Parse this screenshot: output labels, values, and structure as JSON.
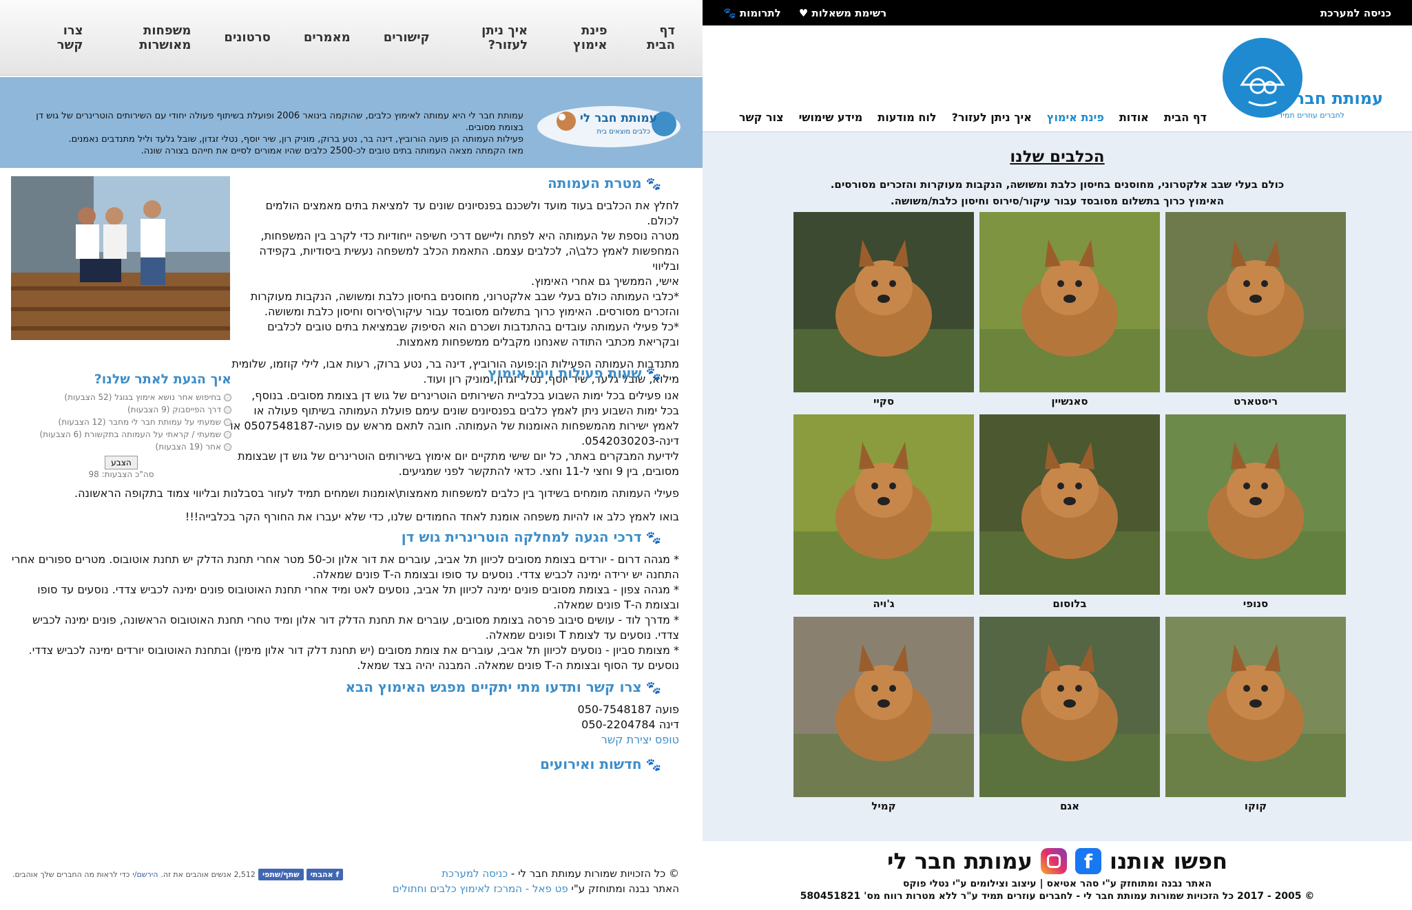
{
  "left": {
    "nav": [
      "דף הבית",
      "פינת אימוץ",
      "איך ניתן לעזור?",
      "קישורים",
      "מאמרים",
      "סרטונים",
      "משפחות מאושרות",
      "צרו קשר"
    ],
    "header_desc": [
      "עמותת חבר לי היא עמותה לאימוץ כלבים, שהוקמה בינואר 2006 ופועלת בשיתוף פעולה יחודי עם השירותים הוטרינרים של גוש דן בצומת מסובים.",
      "פעילות העמותה הן פועה הורוביץ, דינה בר, נטע ברוק, מוניק רון, שיר יוסף, נטלי זגדון, שובל גלעד וליל מתנדבים נאמנים.",
      "מאז הקמתה מצאה העמותה בתים טובים לכ-2500 כלבים שהיו אמורים לסיים את חייהם בצורה שונה."
    ],
    "logo_text": "עמותת חבר לי",
    "logo_sub": "כלבים מוצאים בית",
    "sections": [
      {
        "title": "מטרת העמותה",
        "paragraphs": [
          "לחלץ את הכלבים בעוד מועד ולשכנם בפנסיונים שונים עד למציאת בתים מאמצים הולמים לכולם.",
          "מטרה נוספת של העמותה היא לפתח וליישם דרכי חשיפה ייחודיות כדי לקרב בין המשפחות,",
          "המחפשות לאמץ כלב\\ה, לכלבים עצמם. התאמת הכלב למשפחה נעשית ביסודיות, בקפידה ובליווי",
          "אישי, הממשיך גם אחרי האימוץ.",
          "*כלבי העמותה כולם בעלי שבב אלקטרוני, מחוסנים בחיסון כלבת ומשושה, הנקבות מעוקרות",
          "והזכרים מסורסים. האימוץ כרוך בתשלום מסובסד עבור עיקור\\סירוס וחיסון כלבת ומשושה.",
          "*כל פעילי העמותה עובדים בהתנדבות ושכרם הוא הסיפוק שבמציאת בתים טובים לכלבים",
          "ובקריאת מכתבי התודה שאנחנו מקבלים ממשפחות מאמצות.",
          "",
          "מתנדבות העמותה הפעילות הן:פועה הורוביץ, דינה בר, נטע ברוק, רעות אבו, לילי קוזמו, שלומית",
          "מילוא, שובל גלעד, שיר יוסף, נטלי זגדון, מוניק רון ועוד."
        ]
      },
      {
        "title": "שעות פעילות וימי אימוץ",
        "paragraphs": [
          "אנו פעילים בכל ימות השבוע בכלביית השירותים הוטרינרים של גוש דן בצומת מסובים. בנוסף,",
          "בכל ימות השבוע ניתן לאמץ כלבים בפנסיונים שונים עימם פועלת העמותה בשיתוף פעולה או",
          "לאמץ ישירות מהמשפחות האומנות של העמותה. חובה לתאם מראש עם פועה-0507548187 או",
          "דינה-0542030203.",
          "לידיעת המבקרים באתר, כל יום שישי מתקיים יום אימוץ בשירותים הוטרינרים של גוש דן שבצומת",
          "מסובים, בין 9 וחצי ל-11 וחצי. כדאי להתקשר לפני שמגיעים.",
          "",
          "פעילי העמותה מומחים בשידוך בין כלבים למשפחות מאמצות\\אומנות ושמחים תמיד לעזור בסבלנות ובליווי צמוד בתקופה הראשונה.",
          "",
          "בואו לאמץ כלב או להיות משפחה אומנת לאחד החמודים שלנו, כדי שלא יעברו את החורף הקר בכלבייה!!!"
        ]
      },
      {
        "title": "דרכי הגעה למחלקה הוטרינרית גוש דן",
        "paragraphs": [
          "* מגהה דרום - יורדים בצומת מסובים לכיוון תל אביב, עוברים את דור אלון וכ-50 מטר אחרי תחנת הדלק יש תחנת אוטובוס. מטרים ספורים אחרי",
          "התחנה יש ירידה ימינה לכביש צדדי. נוסעים עד סופו ובצומת ה-T פונים שמאלה.",
          "* מגהה צפון - בצומת מסובים פונים ימינה לכיוון תל אביב, נוסעים לאט ומיד אחרי תחנת האוטובוס פונים ימינה לכביש צדדי. נוסעים עד סופו",
          "ובצומת ה-T פונים שמאלה.",
          "* מדרך לוד - עושים סיבוב פרסה בצומת מסובים, עוברים את תחנת הדלק דור אלון ומיד טחרי תחנת האוטובוס הראשונה, פונים ימינה לכביש",
          "צדדי. נוסעים עד לצומת T ופונים שמאלה.",
          "* מצומת סביון - נוסעים לכיוון תל אביב, עוברים את צומת מסובים (יש תחנת דלק דור אלון מימין) ובתחנת האוטובוס יורדים ימינה לכביש צדדי.",
          "נוסעים עד הסוף ובצומת ה-T פונים שמאלה. המבנה יהיה בצד שמאל."
        ]
      },
      {
        "title": "צרו קשר ותדעו מתי יתקיים מפגש האימוץ הבא",
        "paragraphs": [
          "פועה 050-7548187",
          "דינה 050-2204784"
        ],
        "link": "טופס יצירת קשר"
      },
      {
        "title": "חדשות ואירועים",
        "paragraphs": []
      }
    ],
    "poll": {
      "title": "איך הגעת לאתר שלנו?",
      "options": [
        "בחיפוש אחר נושא אימוץ בגוגל (52 הצבעות)",
        "דרך הפייסבוק (9 הצבעות)",
        "שמעתי על עמותת חבר לי מחבר (12 הצבעות)",
        "שמעתי / קראתי על העמותה בתקשורת (6 הצבעות)",
        "אחר (19 הצבעות)"
      ],
      "button": "הצבע",
      "total": "סה\"כ הצבעות: 98"
    },
    "footer": {
      "copyright": "© כל הזכויות שמורות עמותת חבר לי - ",
      "login_link": "כניסה למערכת",
      "built_by": "האתר נבנה ומתוחזק ע\"י ",
      "built_link": "פט פאל - המרכז לאימוץ כלבים וחתולים",
      "fb_like": "אהבתי",
      "fb_share": "שתף/שתפי",
      "fb_text": "2,512 אנשים אוהבים את זה.",
      "fb_signup": "הירשם/י",
      "fb_tail": "כדי לראות מה החברים שלך אוהבים."
    }
  },
  "right": {
    "topbar": {
      "login": "כניסה למערכת",
      "questions": "רשימת משאלות",
      "donations": "לתרומות"
    },
    "logo_title": "עמותת חבר לי",
    "logo_sub": "לחברים עוזרים תמיד",
    "nav": [
      "דף הבית",
      "אודות",
      "פינת אימוץ",
      "איך ניתן לעזור?",
      "לוח מודעות",
      "מידע שימושי",
      "צור קשר"
    ],
    "nav_active": 2,
    "title": "הכלבים שלנו",
    "subtitle_lines": [
      "כולם בעלי שבב אלקטרוני, מחוסנים בחיסון כלבת ומשושה, הנקבות מעוקרות והזכרים מסורסים.",
      "האימוץ כרוך בתשלום מסובסד עבור עיקור/סירוס וחיסון כלבת/משושה."
    ],
    "dogs": [
      {
        "name": "ריסטארט",
        "bg": "#6e7a4c"
      },
      {
        "name": "סאנשיין",
        "bg": "#7f9440"
      },
      {
        "name": "סקיי",
        "bg": "#3b4a30"
      },
      {
        "name": "סנופי",
        "bg": "#6c8a4a"
      },
      {
        "name": "בלוסום",
        "bg": "#4b5830"
      },
      {
        "name": "ג'ויה",
        "bg": "#8a9c3e"
      },
      {
        "name": "קוקו",
        "bg": "#7a8a58"
      },
      {
        "name": "אגם",
        "bg": "#556644"
      },
      {
        "name": "קמיל",
        "bg": "#8a8070"
      }
    ],
    "footer": {
      "find_us": "חפשו אותנו",
      "org": "עמותת חבר לי",
      "credits": "האתר נבנה ומתוחזק ע\"י סהר אטיאס | עיצוב וצילומים ע\"י נטלי פוקס",
      "copyright": "© 2005 - 2017 כל הזכויות שמורות עמותת חבר לי - לחברים עוזרים תמיד ע\"ר ללא מטרות רווח מס' 580451821"
    }
  }
}
